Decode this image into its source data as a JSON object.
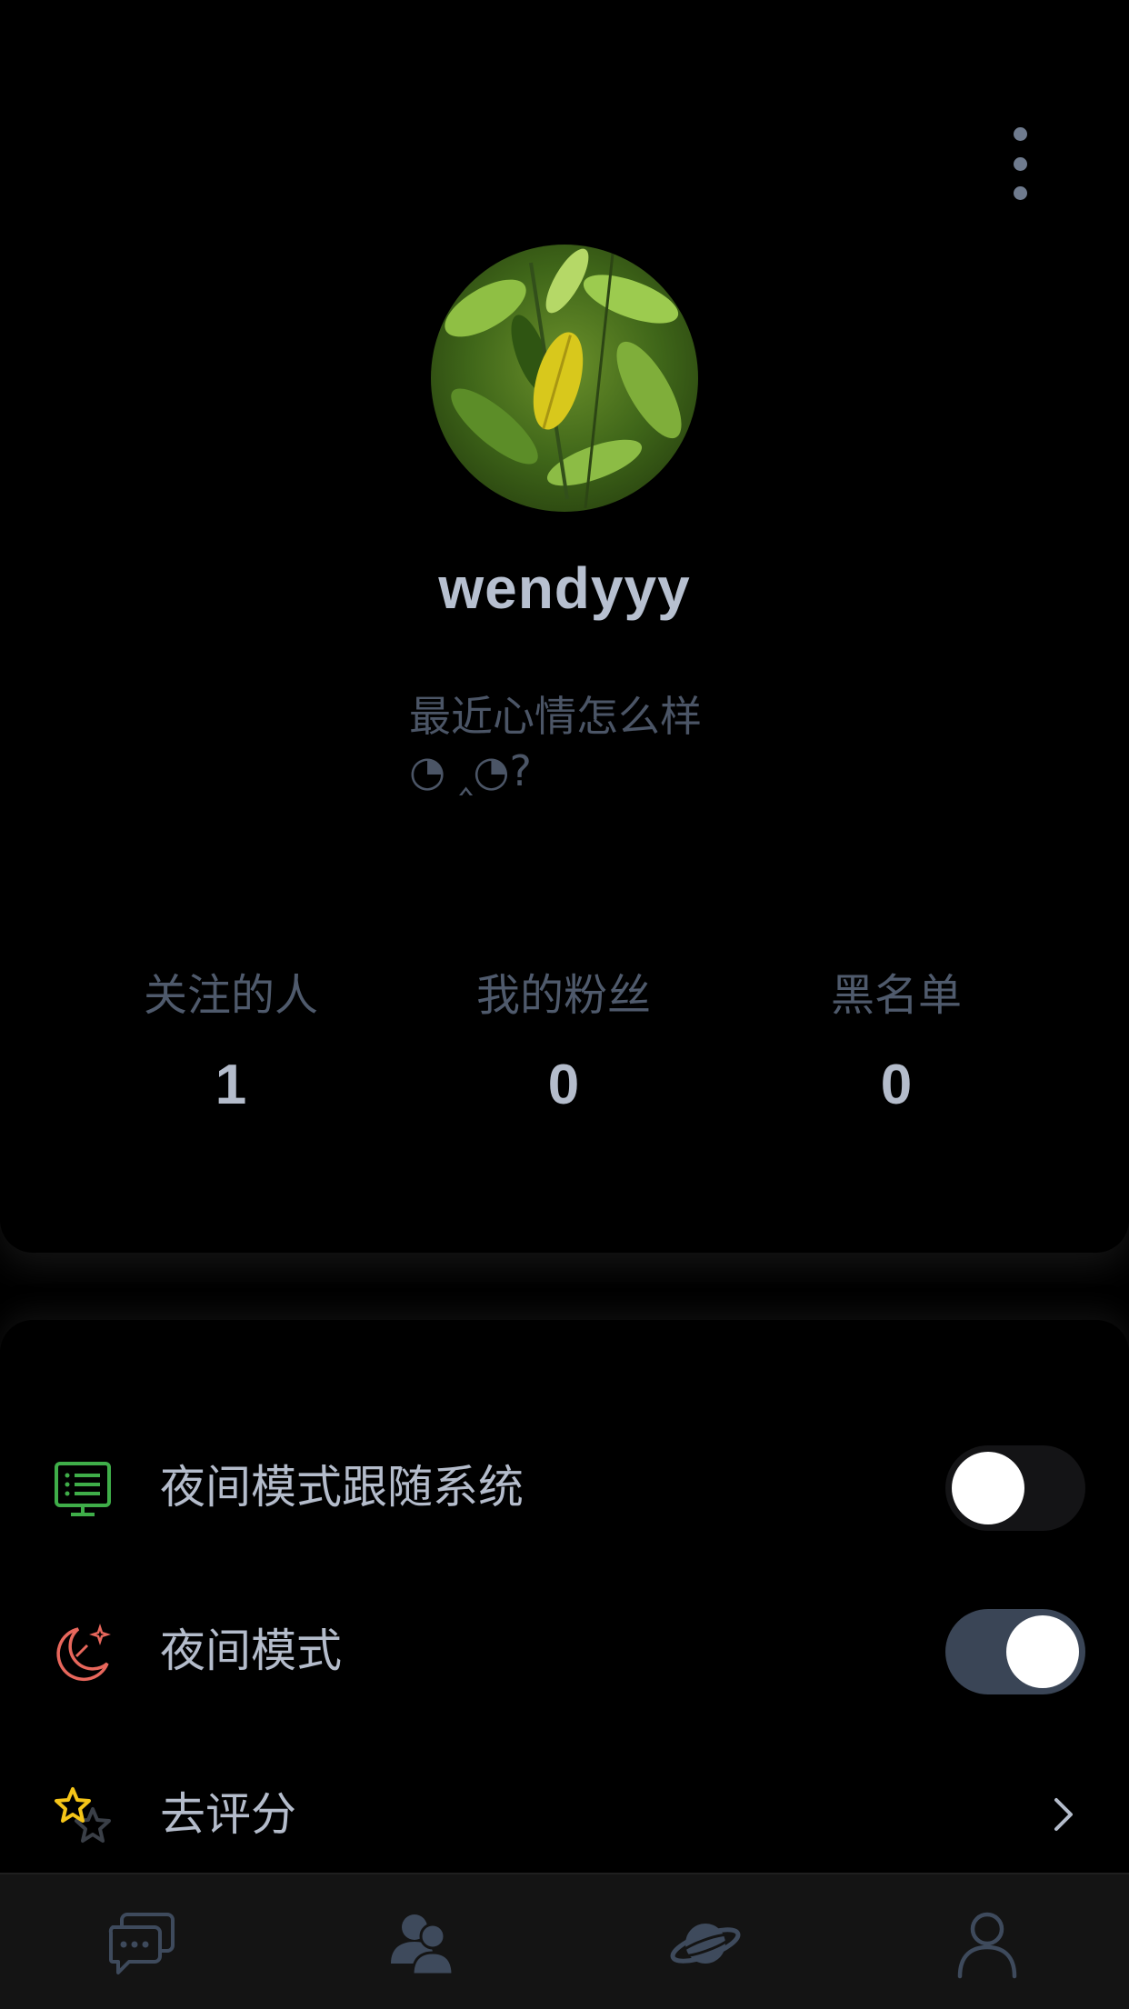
{
  "profile": {
    "username": "wendyyy",
    "bio": "最近心情怎么样\n◔ ‸◔?",
    "stats": [
      {
        "label": "关注的人",
        "value": "1"
      },
      {
        "label": "我的粉丝",
        "value": "0"
      },
      {
        "label": "黑名单",
        "value": "0"
      }
    ],
    "more_icon": "more-vertical-icon"
  },
  "settings": {
    "items": [
      {
        "label": "夜间模式跟随系统",
        "icon": "monitor-list-icon",
        "icon_color": "#3fae49",
        "control": "toggle",
        "state": "off"
      },
      {
        "label": "夜间模式",
        "icon": "moon-stars-icon",
        "icon_color": "#e8675c",
        "control": "toggle",
        "state": "on"
      },
      {
        "label": "去评分",
        "icon": "star-rating-icon",
        "icon_color": "#f5c518",
        "control": "chevron"
      }
    ]
  },
  "tab_bar": {
    "tabs": [
      {
        "name": "messages",
        "icon": "chat-bubbles-icon"
      },
      {
        "name": "contacts",
        "icon": "users-icon"
      },
      {
        "name": "discover",
        "icon": "planet-icon"
      },
      {
        "name": "profile",
        "icon": "person-icon",
        "active": true
      }
    ]
  },
  "colors": {
    "background": "#000000",
    "text_primary": "#b4bccb",
    "text_secondary": "#4f5a6c",
    "icon_muted": "#3e4a5c",
    "toggle_on": "#3a4556",
    "tab_bar": "#141414"
  }
}
